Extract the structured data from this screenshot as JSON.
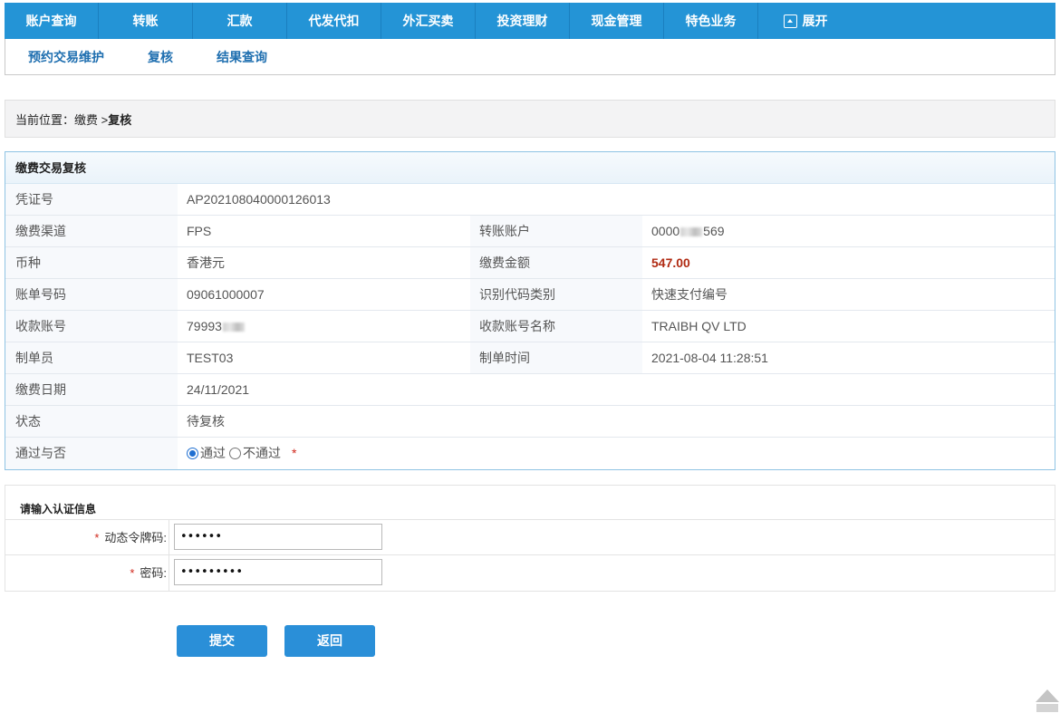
{
  "topnav": {
    "items": [
      "账户查询",
      "转账",
      "汇款",
      "代发代扣",
      "外汇买卖",
      "投资理财",
      "现金管理",
      "特色业务"
    ],
    "expand_label": "展开"
  },
  "subnav": {
    "items": [
      "预约交易维护",
      "复核",
      "结果查询"
    ]
  },
  "breadcrumb": {
    "prefix": "当前位置：缴费 > ",
    "current": "复核"
  },
  "detail": {
    "title": "缴费交易复核",
    "voucher_label": "凭证号",
    "voucher_value": "AP202108040000126013",
    "channel_label": "缴费渠道",
    "channel_value": "FPS",
    "transfer_account_label": "转账账户",
    "transfer_account_prefix": "0000",
    "transfer_account_suffix": "569",
    "currency_label": "币种",
    "currency_value": "香港元",
    "amount_label": "缴费金额",
    "amount_value": "547.00",
    "bill_no_label": "账单号码",
    "bill_no_value": "09061000007",
    "id_type_label": "识别代码类别",
    "id_type_value": "快速支付编号",
    "payee_account_label": "收款账号",
    "payee_account_prefix": "79993",
    "payee_name_label": "收款账号名称",
    "payee_name_value": "TRAIBH QV LTD",
    "maker_label": "制单员",
    "maker_value": "TEST03",
    "make_time_label": "制单时间",
    "make_time_value": "2021-08-04 11:28:51",
    "pay_date_label": "缴费日期",
    "pay_date_value": "24/11/2021",
    "status_label": "状态",
    "status_value": "待复核",
    "approve_label": "通过与否",
    "approve_yes": "通过",
    "approve_no": "不通过",
    "required_mark": "*"
  },
  "auth": {
    "title": "请输入认证信息",
    "token_label": "动态令牌码:",
    "token_value": "••••••",
    "password_label": "密码:",
    "password_value": "•••••••••",
    "required_mark": "*"
  },
  "buttons": {
    "submit": "提交",
    "back": "返回"
  },
  "colors": {
    "nav_bg": "#2494d6",
    "link": "#1f6fb0",
    "amount": "#b02a12",
    "required": "#d0271b",
    "button": "#2a8fd8"
  }
}
